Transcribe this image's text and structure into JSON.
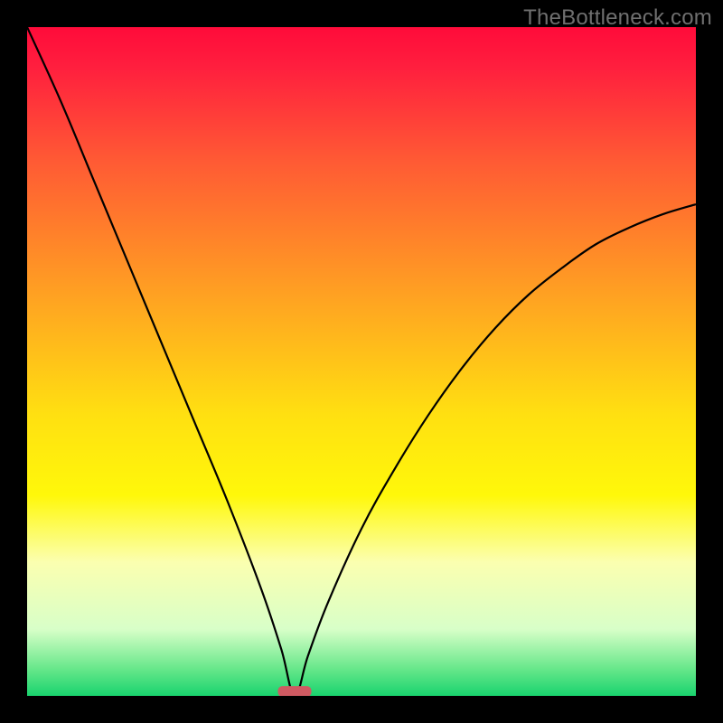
{
  "watermark": "TheBottleneck.com",
  "chart_data": {
    "type": "line",
    "title": "",
    "xlabel": "",
    "ylabel": "",
    "xlim": [
      0,
      100
    ],
    "ylim": [
      0,
      100
    ],
    "x_min_at": 40,
    "series": [
      {
        "name": "bottleneck-curve",
        "description": "V-shaped bottleneck curve over red-yellow-green vertical gradient; minimum near x≈40 where a small red marker sits on the green baseline.",
        "x": [
          0,
          5,
          10,
          15,
          20,
          25,
          30,
          35,
          38,
          40,
          42,
          45,
          50,
          55,
          60,
          65,
          70,
          75,
          80,
          85,
          90,
          95,
          100
        ],
        "values": [
          100,
          89,
          77,
          65,
          53,
          41,
          29,
          16,
          7,
          0,
          6,
          14,
          25,
          34,
          42,
          49,
          55,
          60,
          64,
          67.5,
          70,
          72,
          73.5
        ]
      }
    ],
    "marker": {
      "x": 40,
      "y": 0,
      "width_pct": 5,
      "height_pct": 1.6
    },
    "gradient_stops": [
      {
        "pct": 0,
        "color": "#ff0b3a"
      },
      {
        "pct": 6,
        "color": "#ff1f3e"
      },
      {
        "pct": 20,
        "color": "#ff5a34"
      },
      {
        "pct": 40,
        "color": "#ffa122"
      },
      {
        "pct": 58,
        "color": "#ffe011"
      },
      {
        "pct": 70,
        "color": "#fff80a"
      },
      {
        "pct": 80,
        "color": "#fbffb0"
      },
      {
        "pct": 90,
        "color": "#d8ffc8"
      },
      {
        "pct": 96,
        "color": "#66e78a"
      },
      {
        "pct": 100,
        "color": "#19d36e"
      }
    ],
    "colors": {
      "curve": "#000000",
      "marker_fill": "#cf5a62",
      "frame": "#000000"
    }
  }
}
